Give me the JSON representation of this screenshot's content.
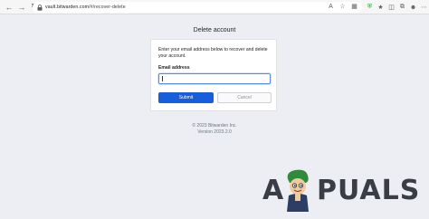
{
  "browser": {
    "url_host": "vault.bitwarden.com",
    "url_path": "/#/recover-delete",
    "nav_icons": [
      "back-arrow-icon",
      "forward-arrow-icon",
      "refresh-icon"
    ],
    "url_icons": [
      "star-icon",
      "extension-icon",
      "reader-icon",
      "favorites-icon"
    ],
    "toolbar_icons": [
      "shield-extension-icon",
      "copy-icon",
      "collections-icon",
      "profile-icon",
      "menu-icon"
    ]
  },
  "page": {
    "title": "Delete account",
    "description": "Enter your email address below to recover and delete your account.",
    "email_label": "Email address",
    "email_value": "",
    "submit_label": "Submit",
    "cancel_label": "Cancel",
    "copyright": "© 2023 Bitwarden Inc.",
    "version": "Version 2023.2.0"
  },
  "watermark": {
    "text_left": "A",
    "text_right": "PUALS"
  },
  "colors": {
    "accent": "#175ddc",
    "page_background": "#eceef3"
  }
}
